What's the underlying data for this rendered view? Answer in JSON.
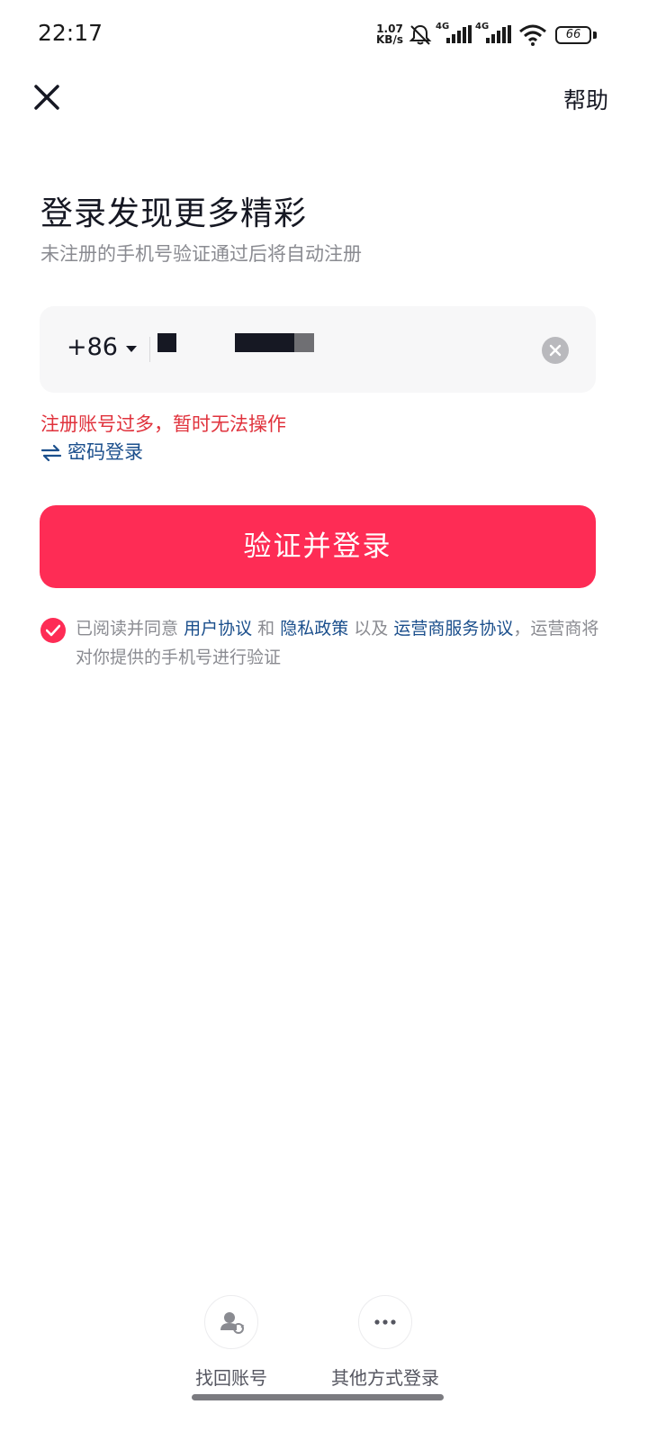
{
  "status_bar": {
    "time": "22:17",
    "net_speed_value": "1.07",
    "net_speed_unit": "KB/s",
    "signal1_label": "4G",
    "signal2_label": "4G",
    "battery": "66",
    "icons": [
      "bell-muted-icon",
      "signal-icon",
      "wifi-icon",
      "battery-icon"
    ]
  },
  "nav": {
    "close_icon": "close-icon",
    "help_label": "帮助"
  },
  "page": {
    "title": "登录发现更多精彩",
    "subtitle": "未注册的手机号验证通过后将自动注册"
  },
  "phone_form": {
    "country_code": "+86",
    "phone_value": "",
    "clear_icon": "clear-icon",
    "error_message": "注册账号过多，暂时无法操作",
    "password_login_label": "密码登录"
  },
  "submit": {
    "label": "验证并登录"
  },
  "agreement": {
    "checked": true,
    "prefix": "已阅读并同意",
    "user_agreement": "用户协议",
    "and": "和",
    "privacy_policy": "隐私政策",
    "and_also": "以及",
    "carrier_agreement": "运营商服务协议",
    "suffix": "，运营商将对你提供的手机号进行验证"
  },
  "bottom": {
    "recover_label": "找回账号",
    "other_label": "其他方式登录"
  },
  "colors": {
    "accent": "#fe2c55",
    "link": "#1b4f8c",
    "error": "#e0323c"
  }
}
